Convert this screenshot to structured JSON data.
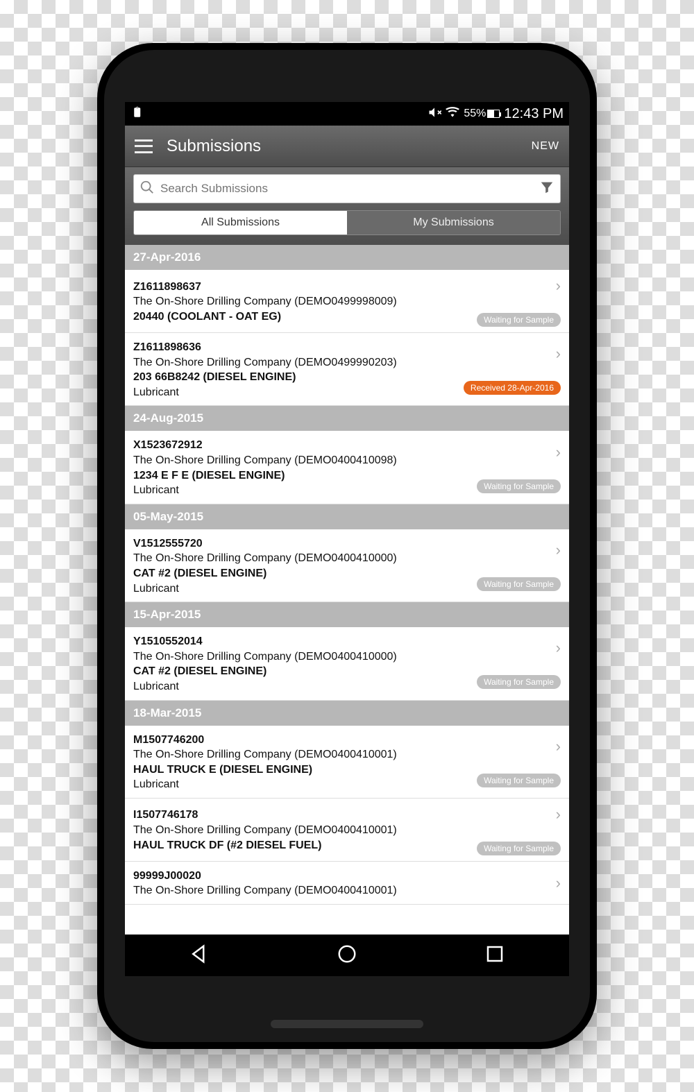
{
  "status": {
    "battery_pct": "55%",
    "time": "12:43 PM"
  },
  "appbar": {
    "title": "Submissions",
    "new_label": "NEW"
  },
  "search": {
    "placeholder": "Search Submissions"
  },
  "tabs": {
    "all": "All Submissions",
    "mine": "My Submissions"
  },
  "groups": [
    {
      "date": "27-Apr-2016",
      "items": [
        {
          "id": "Z1611898637",
          "company": "The On-Shore Drilling Company (DEMO0499998009)",
          "desc": "20440 (COOLANT - OAT EG)",
          "type": "",
          "badge": "Waiting for Sample",
          "badge_style": "gray"
        },
        {
          "id": "Z1611898636",
          "company": "The On-Shore Drilling Company (DEMO0499990203)",
          "desc": "203 66B8242 (DIESEL ENGINE)",
          "type": "Lubricant",
          "badge": "Received 28-Apr-2016",
          "badge_style": "orange"
        }
      ]
    },
    {
      "date": "24-Aug-2015",
      "items": [
        {
          "id": "X1523672912",
          "company": "The On-Shore Drilling Company (DEMO0400410098)",
          "desc": "1234 E F E (DIESEL ENGINE)",
          "type": "Lubricant",
          "badge": "Waiting for Sample",
          "badge_style": "gray"
        }
      ]
    },
    {
      "date": "05-May-2015",
      "items": [
        {
          "id": "V1512555720",
          "company": "The On-Shore Drilling Company (DEMO0400410000)",
          "desc": "CAT #2 (DIESEL ENGINE)",
          "type": "Lubricant",
          "badge": "Waiting for Sample",
          "badge_style": "gray"
        }
      ]
    },
    {
      "date": "15-Apr-2015",
      "items": [
        {
          "id": "Y1510552014",
          "company": "The On-Shore Drilling Company (DEMO0400410000)",
          "desc": "CAT #2 (DIESEL ENGINE)",
          "type": "Lubricant",
          "badge": "Waiting for Sample",
          "badge_style": "gray"
        }
      ]
    },
    {
      "date": "18-Mar-2015",
      "items": [
        {
          "id": "M1507746200",
          "company": "The On-Shore Drilling Company (DEMO0400410001)",
          "desc": "HAUL TRUCK E (DIESEL ENGINE)",
          "type": "Lubricant",
          "badge": "Waiting for Sample",
          "badge_style": "gray"
        },
        {
          "id": "I1507746178",
          "company": "The On-Shore Drilling Company (DEMO0400410001)",
          "desc": "HAUL TRUCK DF (#2 DIESEL FUEL)",
          "type": "",
          "badge": "Waiting for Sample",
          "badge_style": "gray"
        },
        {
          "id": "99999J00020",
          "company": "The On-Shore Drilling Company (DEMO0400410001)",
          "desc": "",
          "type": "",
          "badge": "",
          "badge_style": "gray"
        }
      ]
    }
  ]
}
